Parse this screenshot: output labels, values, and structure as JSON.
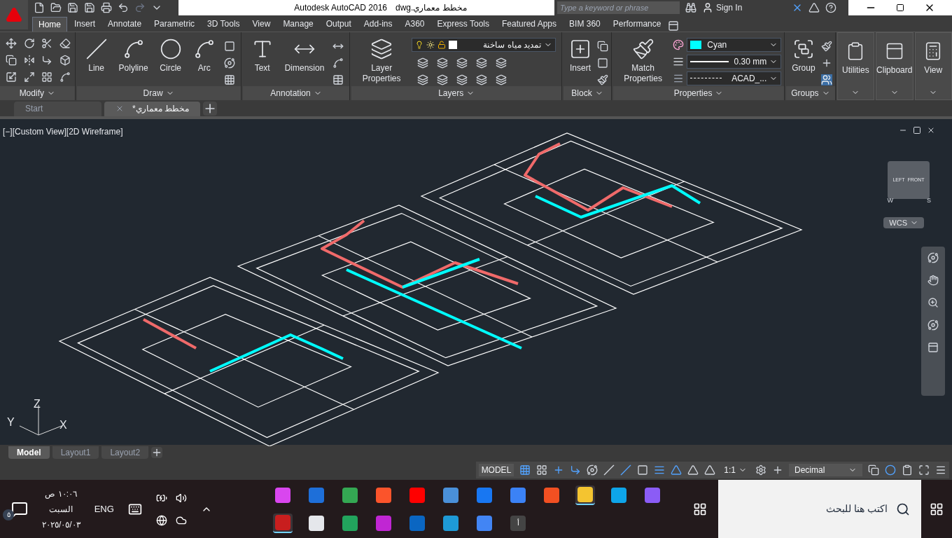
{
  "title_bar": {
    "title": "Autodesk AutoCAD 2016",
    "file": "مخطط معماري.dwg",
    "search": {
      "placeholder": "Type a keyword or phrase"
    },
    "sign_in": "Sign In"
  },
  "ribbon_tabs": [
    {
      "label": "Home",
      "selected": true
    },
    {
      "label": "Insert",
      "selected": false
    },
    {
      "label": "Annotate",
      "selected": false
    },
    {
      "label": "Parametric",
      "selected": false
    },
    {
      "label": "3D Tools",
      "selected": false
    },
    {
      "label": "View",
      "selected": false
    },
    {
      "label": "Manage",
      "selected": false
    },
    {
      "label": "Output",
      "selected": false
    },
    {
      "label": "Add-ins",
      "selected": false
    },
    {
      "label": "A360",
      "selected": false
    },
    {
      "label": "Express Tools",
      "selected": false
    },
    {
      "label": "Featured Apps",
      "selected": false
    },
    {
      "label": "BIM 360",
      "selected": false
    },
    {
      "label": "Performance",
      "selected": false
    }
  ],
  "panels": [
    {
      "kind": "modify",
      "title": "Modify"
    },
    {
      "kind": "draw",
      "title": "Draw",
      "tools": [
        "Line",
        "Polyline",
        "Circle",
        "Arc"
      ]
    },
    {
      "kind": "annotation",
      "title": "Annotation",
      "tools": [
        "Text",
        "Dimension"
      ]
    },
    {
      "kind": "layers",
      "title": "Layers",
      "tools": [
        "Layer Properties"
      ],
      "layer": "تمديد مياه ساخنة"
    },
    {
      "kind": "block",
      "title": "Block",
      "tools": [
        "Insert"
      ]
    },
    {
      "kind": "properties",
      "title": "Properties",
      "tools": [
        "Match Properties"
      ],
      "color_name": "Cyan",
      "lineweight": "0.30 mm",
      "linetype": "ACAD_..."
    },
    {
      "kind": "groups",
      "title": "Groups",
      "tools": [
        "Group"
      ]
    },
    {
      "kind": "collapsed",
      "title": "Utilities"
    },
    {
      "kind": "collapsed",
      "title": "Clipboard"
    },
    {
      "kind": "collapsed",
      "title": "View"
    }
  ],
  "document_tabs": [
    {
      "label": "Start",
      "selected": false
    },
    {
      "label": "مخطط معماري*",
      "selected": true
    }
  ],
  "viewport": {
    "label": "[−][Custom View][2D Wireframe]",
    "viewcube": {
      "faces": [
        "LEFT",
        "FRONT"
      ],
      "compass": [
        "W",
        "S"
      ]
    },
    "wcs": "WCS",
    "ucs_axes": [
      "Z",
      "Y",
      "X"
    ]
  },
  "layout_tabs": [
    {
      "label": "Model",
      "selected": true
    },
    {
      "label": "Layout1",
      "selected": false
    },
    {
      "label": "Layout2",
      "selected": false
    }
  ],
  "status_bar": {
    "space": "MODEL",
    "scale": "1:1",
    "units": "Decimal"
  },
  "taskbar": {
    "time": "١٠:٠٦ ص",
    "day": "السبت",
    "date": "٢٠٢٥/٠٥/٠٣",
    "language": "ENG",
    "notifications": "٥",
    "search": {
      "placeholder": "اكتب هنا للبحث"
    },
    "apps": [
      {
        "color": "#d946ef",
        "running": false
      },
      {
        "color": "#1e6fd9",
        "running": false
      },
      {
        "color": "#34a853",
        "running": false
      },
      {
        "color": "#fb542b",
        "running": false
      },
      {
        "color": "#ff0000",
        "running": false
      },
      {
        "color": "#4a90d9",
        "running": false
      },
      {
        "color": "#1877f2",
        "running": false
      },
      {
        "color": "#3b82f6",
        "running": false
      },
      {
        "color": "#f25022",
        "running": false
      },
      {
        "color": "#f4c430",
        "running": true
      },
      {
        "color": "#0ea5e9",
        "running": false
      },
      {
        "color": "#8b5cf6",
        "running": false
      },
      {
        "color": "#c81e1e",
        "running": true
      },
      {
        "color": "#e5e7eb",
        "running": false
      },
      {
        "color": "#22a45d",
        "running": false
      },
      {
        "color": "#c026d3",
        "running": false
      },
      {
        "color": "#0a66c2",
        "running": false
      },
      {
        "color": "#1e9ad6",
        "running": false
      },
      {
        "color": "#4285f4",
        "running": false
      },
      {
        "color": "#444444",
        "running": false,
        "label": "أ"
      }
    ]
  }
}
